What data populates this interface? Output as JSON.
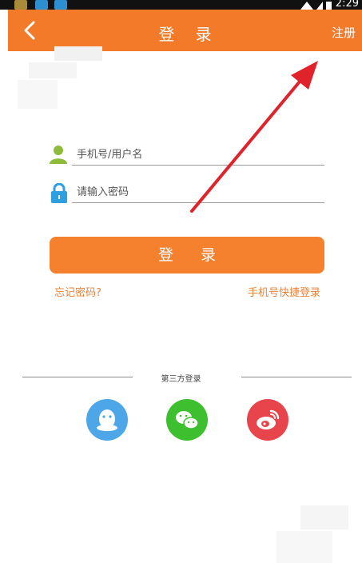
{
  "status_bar": {
    "time": "2:29"
  },
  "topbar": {
    "title": "登 录",
    "register_label": "注册"
  },
  "form": {
    "username_placeholder": "手机号/用户名",
    "password_placeholder": "请输入密码",
    "login_label": "登 录",
    "forgot_password": "忘记密码?",
    "quick_login": "手机号快捷登录"
  },
  "third_party": {
    "label": "第三方登录",
    "options": [
      {
        "name": "qq-icon",
        "color": "#4da6e7"
      },
      {
        "name": "wechat-icon",
        "color": "#3dbf2f"
      },
      {
        "name": "weibo-icon",
        "color": "#e8444b"
      }
    ]
  },
  "colors": {
    "accent": "#f27a28",
    "button": "#f5812f",
    "link": "#e8833a",
    "annotation_arrow": "#e0222a"
  }
}
